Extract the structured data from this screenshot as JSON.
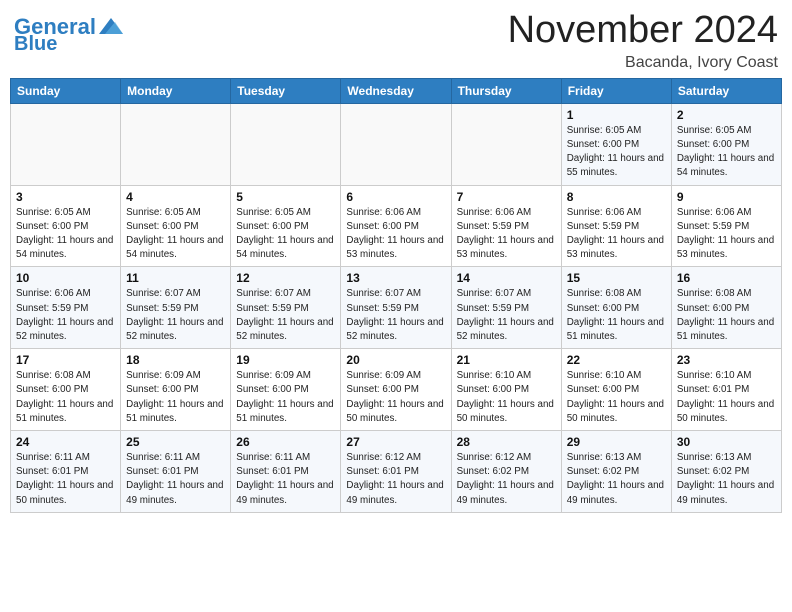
{
  "header": {
    "logo_line1": "General",
    "logo_line2": "Blue",
    "month": "November 2024",
    "location": "Bacanda, Ivory Coast"
  },
  "days_of_week": [
    "Sunday",
    "Monday",
    "Tuesday",
    "Wednesday",
    "Thursday",
    "Friday",
    "Saturday"
  ],
  "weeks": [
    [
      {
        "day": "",
        "info": ""
      },
      {
        "day": "",
        "info": ""
      },
      {
        "day": "",
        "info": ""
      },
      {
        "day": "",
        "info": ""
      },
      {
        "day": "",
        "info": ""
      },
      {
        "day": "1",
        "info": "Sunrise: 6:05 AM\nSunset: 6:00 PM\nDaylight: 11 hours and 55 minutes."
      },
      {
        "day": "2",
        "info": "Sunrise: 6:05 AM\nSunset: 6:00 PM\nDaylight: 11 hours and 54 minutes."
      }
    ],
    [
      {
        "day": "3",
        "info": "Sunrise: 6:05 AM\nSunset: 6:00 PM\nDaylight: 11 hours and 54 minutes."
      },
      {
        "day": "4",
        "info": "Sunrise: 6:05 AM\nSunset: 6:00 PM\nDaylight: 11 hours and 54 minutes."
      },
      {
        "day": "5",
        "info": "Sunrise: 6:05 AM\nSunset: 6:00 PM\nDaylight: 11 hours and 54 minutes."
      },
      {
        "day": "6",
        "info": "Sunrise: 6:06 AM\nSunset: 6:00 PM\nDaylight: 11 hours and 53 minutes."
      },
      {
        "day": "7",
        "info": "Sunrise: 6:06 AM\nSunset: 5:59 PM\nDaylight: 11 hours and 53 minutes."
      },
      {
        "day": "8",
        "info": "Sunrise: 6:06 AM\nSunset: 5:59 PM\nDaylight: 11 hours and 53 minutes."
      },
      {
        "day": "9",
        "info": "Sunrise: 6:06 AM\nSunset: 5:59 PM\nDaylight: 11 hours and 53 minutes."
      }
    ],
    [
      {
        "day": "10",
        "info": "Sunrise: 6:06 AM\nSunset: 5:59 PM\nDaylight: 11 hours and 52 minutes."
      },
      {
        "day": "11",
        "info": "Sunrise: 6:07 AM\nSunset: 5:59 PM\nDaylight: 11 hours and 52 minutes."
      },
      {
        "day": "12",
        "info": "Sunrise: 6:07 AM\nSunset: 5:59 PM\nDaylight: 11 hours and 52 minutes."
      },
      {
        "day": "13",
        "info": "Sunrise: 6:07 AM\nSunset: 5:59 PM\nDaylight: 11 hours and 52 minutes."
      },
      {
        "day": "14",
        "info": "Sunrise: 6:07 AM\nSunset: 5:59 PM\nDaylight: 11 hours and 52 minutes."
      },
      {
        "day": "15",
        "info": "Sunrise: 6:08 AM\nSunset: 6:00 PM\nDaylight: 11 hours and 51 minutes."
      },
      {
        "day": "16",
        "info": "Sunrise: 6:08 AM\nSunset: 6:00 PM\nDaylight: 11 hours and 51 minutes."
      }
    ],
    [
      {
        "day": "17",
        "info": "Sunrise: 6:08 AM\nSunset: 6:00 PM\nDaylight: 11 hours and 51 minutes."
      },
      {
        "day": "18",
        "info": "Sunrise: 6:09 AM\nSunset: 6:00 PM\nDaylight: 11 hours and 51 minutes."
      },
      {
        "day": "19",
        "info": "Sunrise: 6:09 AM\nSunset: 6:00 PM\nDaylight: 11 hours and 51 minutes."
      },
      {
        "day": "20",
        "info": "Sunrise: 6:09 AM\nSunset: 6:00 PM\nDaylight: 11 hours and 50 minutes."
      },
      {
        "day": "21",
        "info": "Sunrise: 6:10 AM\nSunset: 6:00 PM\nDaylight: 11 hours and 50 minutes."
      },
      {
        "day": "22",
        "info": "Sunrise: 6:10 AM\nSunset: 6:00 PM\nDaylight: 11 hours and 50 minutes."
      },
      {
        "day": "23",
        "info": "Sunrise: 6:10 AM\nSunset: 6:01 PM\nDaylight: 11 hours and 50 minutes."
      }
    ],
    [
      {
        "day": "24",
        "info": "Sunrise: 6:11 AM\nSunset: 6:01 PM\nDaylight: 11 hours and 50 minutes."
      },
      {
        "day": "25",
        "info": "Sunrise: 6:11 AM\nSunset: 6:01 PM\nDaylight: 11 hours and 49 minutes."
      },
      {
        "day": "26",
        "info": "Sunrise: 6:11 AM\nSunset: 6:01 PM\nDaylight: 11 hours and 49 minutes."
      },
      {
        "day": "27",
        "info": "Sunrise: 6:12 AM\nSunset: 6:01 PM\nDaylight: 11 hours and 49 minutes."
      },
      {
        "day": "28",
        "info": "Sunrise: 6:12 AM\nSunset: 6:02 PM\nDaylight: 11 hours and 49 minutes."
      },
      {
        "day": "29",
        "info": "Sunrise: 6:13 AM\nSunset: 6:02 PM\nDaylight: 11 hours and 49 minutes."
      },
      {
        "day": "30",
        "info": "Sunrise: 6:13 AM\nSunset: 6:02 PM\nDaylight: 11 hours and 49 minutes."
      }
    ]
  ]
}
